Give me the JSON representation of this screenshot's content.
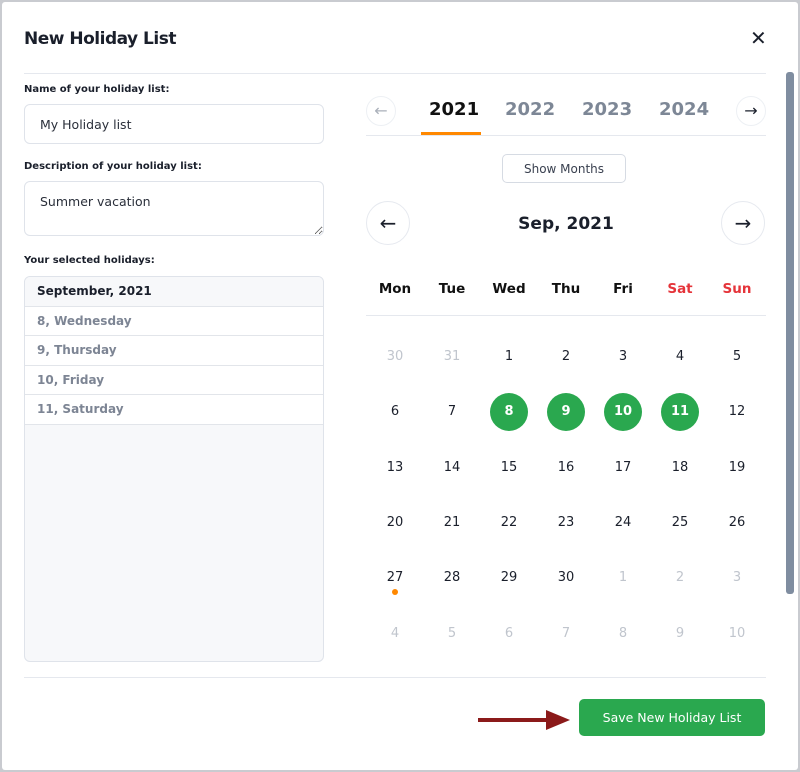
{
  "title": "New Holiday List",
  "name_label": "Name of your holiday list:",
  "name_value": "My Holiday list",
  "desc_label": "Description of your holiday list:",
  "desc_value": "Summer vacation",
  "selected_label": "Your selected holidays:",
  "selected": {
    "header": "September, 2021",
    "items": [
      "8, Wednesday",
      "9, Thursday",
      "10, Friday",
      "11, Saturday"
    ]
  },
  "years": [
    "2021",
    "2022",
    "2023",
    "2024"
  ],
  "active_year": "2021",
  "show_months": "Show Months",
  "month_title": "Sep, 2021",
  "weekdays": [
    "Mon",
    "Tue",
    "Wed",
    "Thu",
    "Fri",
    "Sat",
    "Sun"
  ],
  "weeks": [
    [
      "30",
      "31",
      "1",
      "2",
      "3",
      "4",
      "5"
    ],
    [
      "6",
      "7",
      "8",
      "9",
      "10",
      "11",
      "12"
    ],
    [
      "13",
      "14",
      "15",
      "16",
      "17",
      "18",
      "19"
    ],
    [
      "20",
      "21",
      "22",
      "23",
      "24",
      "25",
      "26"
    ],
    [
      "27",
      "28",
      "29",
      "30",
      "1",
      "2",
      "3"
    ],
    [
      "4",
      "5",
      "6",
      "7",
      "8",
      "9",
      "10"
    ]
  ],
  "selected_days": [
    "8",
    "9",
    "10",
    "11"
  ],
  "today": "27",
  "save_label": "Save New Holiday List",
  "colors": {
    "accent": "#2aa84f",
    "tab_underline": "#ff8800",
    "weekend": "#e5343a",
    "arrow": "#8b1a1a"
  }
}
